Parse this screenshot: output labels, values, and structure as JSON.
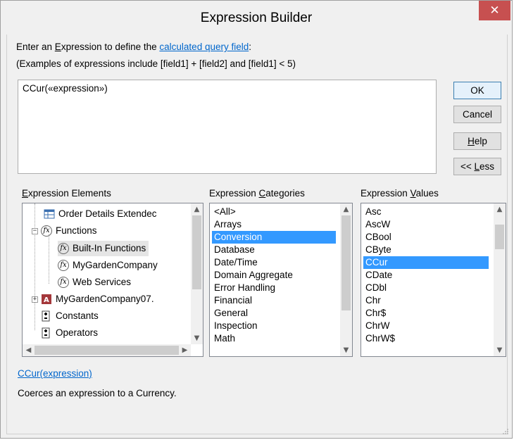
{
  "window": {
    "title": "Expression Builder",
    "close_glyph": "✕"
  },
  "instructions": {
    "line1_pre": "Enter an ",
    "line1_ul": "E",
    "line1_mid": "xpression to define the ",
    "line1_link": "calculated query field",
    "line1_post": ":",
    "line2": "(Examples of expressions include [field1] + [field2] and [field1] < 5)"
  },
  "expression": {
    "value": "CCur(«expression»)"
  },
  "buttons": {
    "ok": "OK",
    "cancel": "Cancel",
    "help_ul": "H",
    "help_rest": "elp",
    "less_pre": "<< ",
    "less_ul": "L",
    "less_rest": "ess"
  },
  "elements": {
    "label_ul": "E",
    "label_rest": "xpression Elements",
    "items": [
      {
        "label": "Order Details Extendec",
        "icon": "query-icon"
      },
      {
        "label": "Functions",
        "icon": "functions-icon"
      },
      {
        "label": "Built-In Functions",
        "icon": "function-icon"
      },
      {
        "label": "MyGardenCompany",
        "icon": "function-icon"
      },
      {
        "label": "Web Services",
        "icon": "function-icon"
      },
      {
        "label": "MyGardenCompany07.",
        "icon": "database-icon"
      },
      {
        "label": "Constants",
        "icon": "constants-icon"
      },
      {
        "label": "Operators",
        "icon": "operators-icon"
      }
    ]
  },
  "categories": {
    "label_pre": "Expression ",
    "label_ul": "C",
    "label_rest": "ategories",
    "items": [
      "<All>",
      "Arrays",
      "Conversion",
      "Database",
      "Date/Time",
      "Domain Aggregate",
      "Error Handling",
      "Financial",
      "General",
      "Inspection",
      "Math"
    ],
    "selected": "Conversion"
  },
  "values": {
    "label_pre": "Expression ",
    "label_ul": "V",
    "label_rest": "alues",
    "items": [
      "Asc",
      "AscW",
      "CBool",
      "CByte",
      "CCur",
      "CDate",
      "CDbl",
      "Chr",
      "Chr$",
      "ChrW",
      "ChrW$"
    ],
    "selected": "CCur"
  },
  "description": {
    "syntax": "CCur(expression)",
    "text": "Coerces an expression to a Currency."
  },
  "colors": {
    "selection": "#3399ff",
    "link": "#0066cc",
    "close": "#c75050"
  }
}
